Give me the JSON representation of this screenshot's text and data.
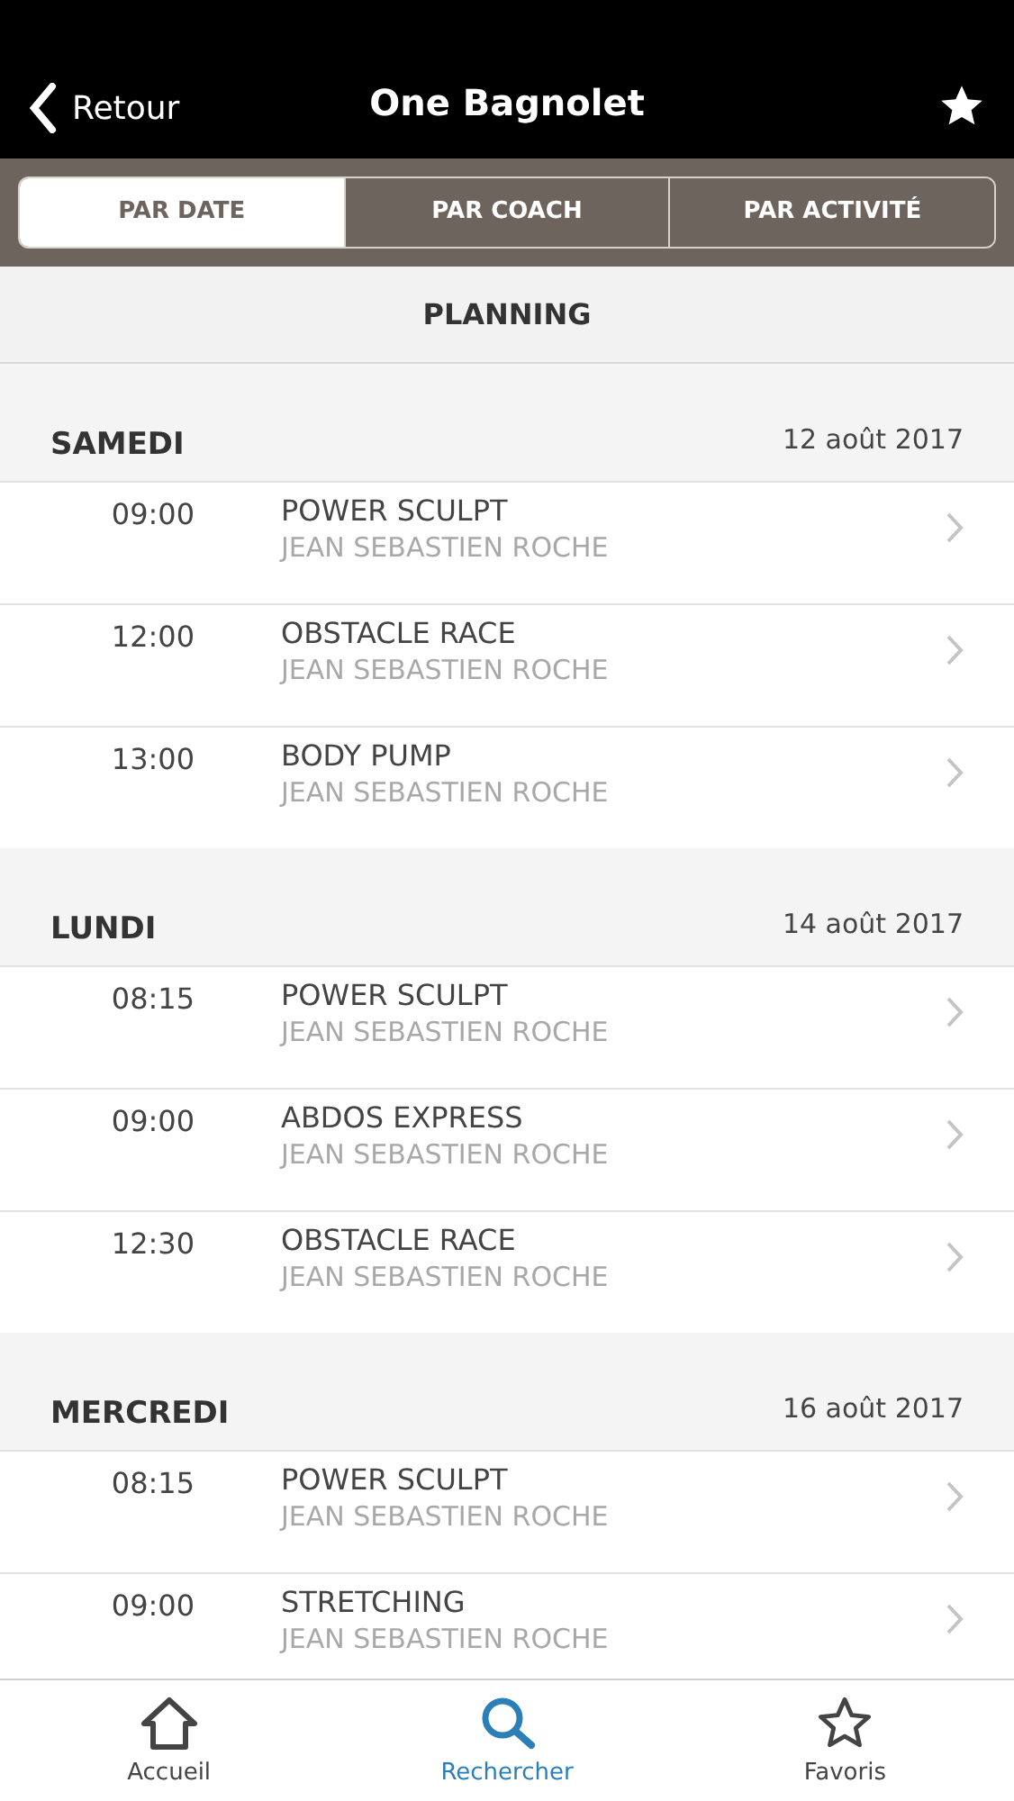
{
  "nav": {
    "back": "Retour",
    "title": "One Bagnolet"
  },
  "tabs": [
    {
      "label": "PAR DATE",
      "selected": true
    },
    {
      "label": "PAR COACH",
      "selected": false
    },
    {
      "label": "PAR ACTIVITÉ",
      "selected": false
    }
  ],
  "section_title": "PLANNING",
  "days": [
    {
      "day": "SAMEDI",
      "date": "12 août 2017",
      "sessions": [
        {
          "time": "09:00",
          "activity": "POWER SCULPT",
          "coach": "JEAN SEBASTIEN ROCHE"
        },
        {
          "time": "12:00",
          "activity": "OBSTACLE RACE",
          "coach": "JEAN SEBASTIEN ROCHE"
        },
        {
          "time": "13:00",
          "activity": "BODY PUMP",
          "coach": "JEAN SEBASTIEN ROCHE"
        }
      ]
    },
    {
      "day": "LUNDI",
      "date": "14 août 2017",
      "sessions": [
        {
          "time": "08:15",
          "activity": "POWER SCULPT",
          "coach": "JEAN SEBASTIEN ROCHE"
        },
        {
          "time": "09:00",
          "activity": "ABDOS EXPRESS",
          "coach": "JEAN SEBASTIEN ROCHE"
        },
        {
          "time": "12:30",
          "activity": "OBSTACLE RACE",
          "coach": "JEAN SEBASTIEN ROCHE"
        }
      ]
    },
    {
      "day": "MERCREDI",
      "date": "16 août 2017",
      "sessions": [
        {
          "time": "08:15",
          "activity": "POWER SCULPT",
          "coach": "JEAN SEBASTIEN ROCHE"
        },
        {
          "time": "09:00",
          "activity": "STRETCHING",
          "coach": "JEAN SEBASTIEN ROCHE"
        }
      ]
    }
  ],
  "tab_bar": [
    {
      "kind": "home",
      "label": "Accueil",
      "selected": false
    },
    {
      "kind": "search",
      "label": "Rechercher",
      "selected": true
    },
    {
      "kind": "star",
      "label": "Favoris",
      "selected": false
    }
  ]
}
